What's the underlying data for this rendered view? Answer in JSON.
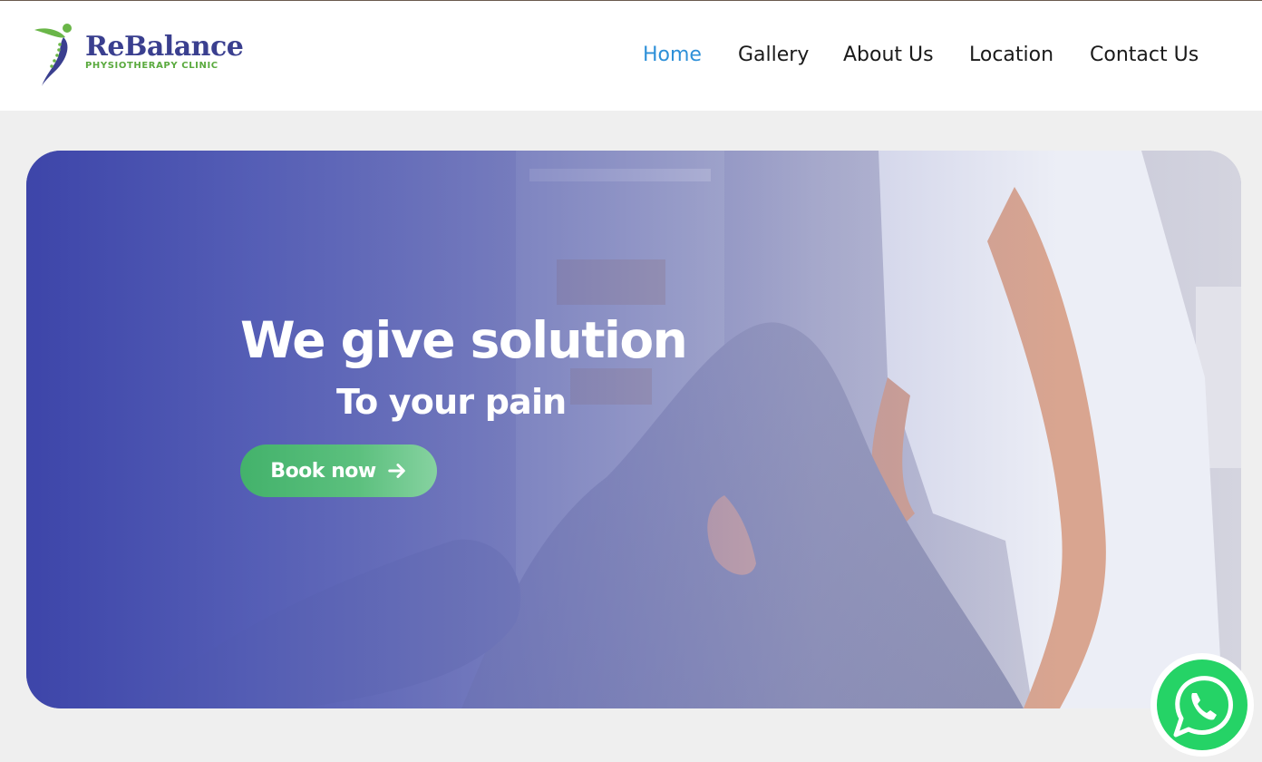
{
  "brand": {
    "name": "ReBalance",
    "tagline": "PHYSIOTHERAPY CLINIC",
    "colors": {
      "name": "#3a3f8f",
      "tagline": "#5aaa3e",
      "mark_green": "#6ab648",
      "mark_blue": "#3a3f8f"
    }
  },
  "nav": {
    "items": [
      {
        "label": "Home",
        "active": true
      },
      {
        "label": "Gallery",
        "active": false
      },
      {
        "label": "About Us",
        "active": false
      },
      {
        "label": "Location",
        "active": false
      },
      {
        "label": "Contact Us",
        "active": false
      }
    ],
    "active_color": "#2e90d8"
  },
  "hero": {
    "title": "We give solution",
    "subtitle": "To your pain",
    "cta_label": "Book now",
    "cta_icon": "arrow-right-icon",
    "image_subject": "physiotherapist-treating-patient-knee"
  },
  "floating": {
    "whatsapp_icon": "whatsapp-icon",
    "color": "#25d366"
  }
}
